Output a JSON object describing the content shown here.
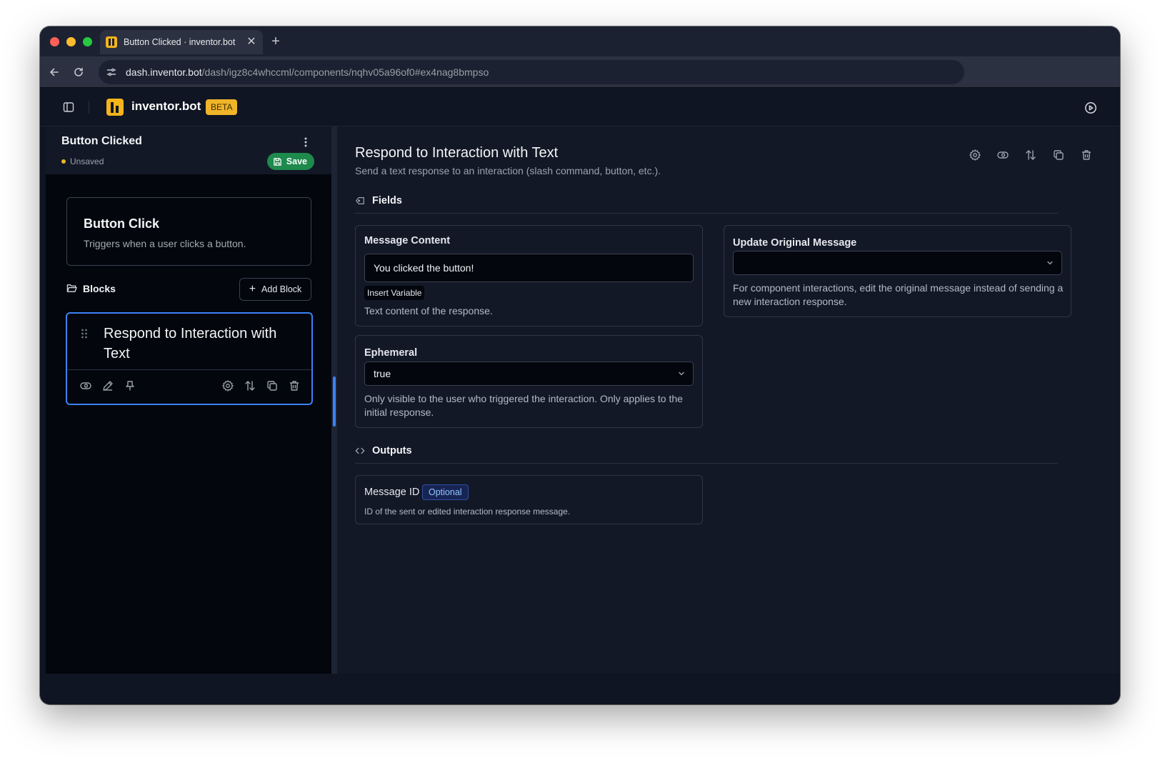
{
  "browser": {
    "tab_title": "Button Clicked · inventor.bot",
    "tab_close": "✕",
    "new_tab": "+",
    "url_host": "dash.inventor.bot",
    "url_path": "/dash/igz8c4whccml/components/nqhv05a96of0#ex4nag8bmpso"
  },
  "app": {
    "brand": "inventor.bot",
    "badge": "BETA"
  },
  "flow": {
    "title": "Button Clicked",
    "status": "Unsaved",
    "save_label": "Save"
  },
  "trigger": {
    "title": "Button Click",
    "description": "Triggers when a user clicks a button."
  },
  "blocks": {
    "label": "Blocks",
    "add_label": "Add Block",
    "items": [
      {
        "title": "Respond to Interaction with Text",
        "actions": [
          "eye-icon",
          "pencil-icon",
          "pin-icon",
          "gear-icon",
          "reorder-icon",
          "copy-icon",
          "trash-icon"
        ]
      }
    ]
  },
  "editor": {
    "title": "Respond to Interaction with Text",
    "subtitle": "Send a text response to an interaction (slash command, button, etc.).",
    "header_actions": [
      "gear-icon",
      "eye-icon",
      "reorder-icon",
      "copy-icon",
      "trash-icon"
    ],
    "fields_label": "Fields",
    "outputs_label": "Outputs",
    "fields": {
      "message_content": {
        "label": "Message Content",
        "value": "You clicked the button!",
        "insert_variable": "Insert Variable",
        "help": "Text content of the response."
      },
      "update_original": {
        "label": "Update Original Message",
        "value": "",
        "help": "For component interactions, edit the original message instead of sending a new interaction response."
      },
      "ephemeral": {
        "label": "Ephemeral",
        "value": "true",
        "help": "Only visible to the user who triggered the interaction. Only applies to the initial response."
      }
    },
    "outputs": [
      {
        "label": "Message ID",
        "badge": "Optional",
        "help": "ID of the sent or edited interaction response message."
      }
    ]
  },
  "colors": {
    "accent": "#3b82f6",
    "brand": "#f4b41a",
    "save": "#1e8a4c",
    "background": "#121826"
  }
}
